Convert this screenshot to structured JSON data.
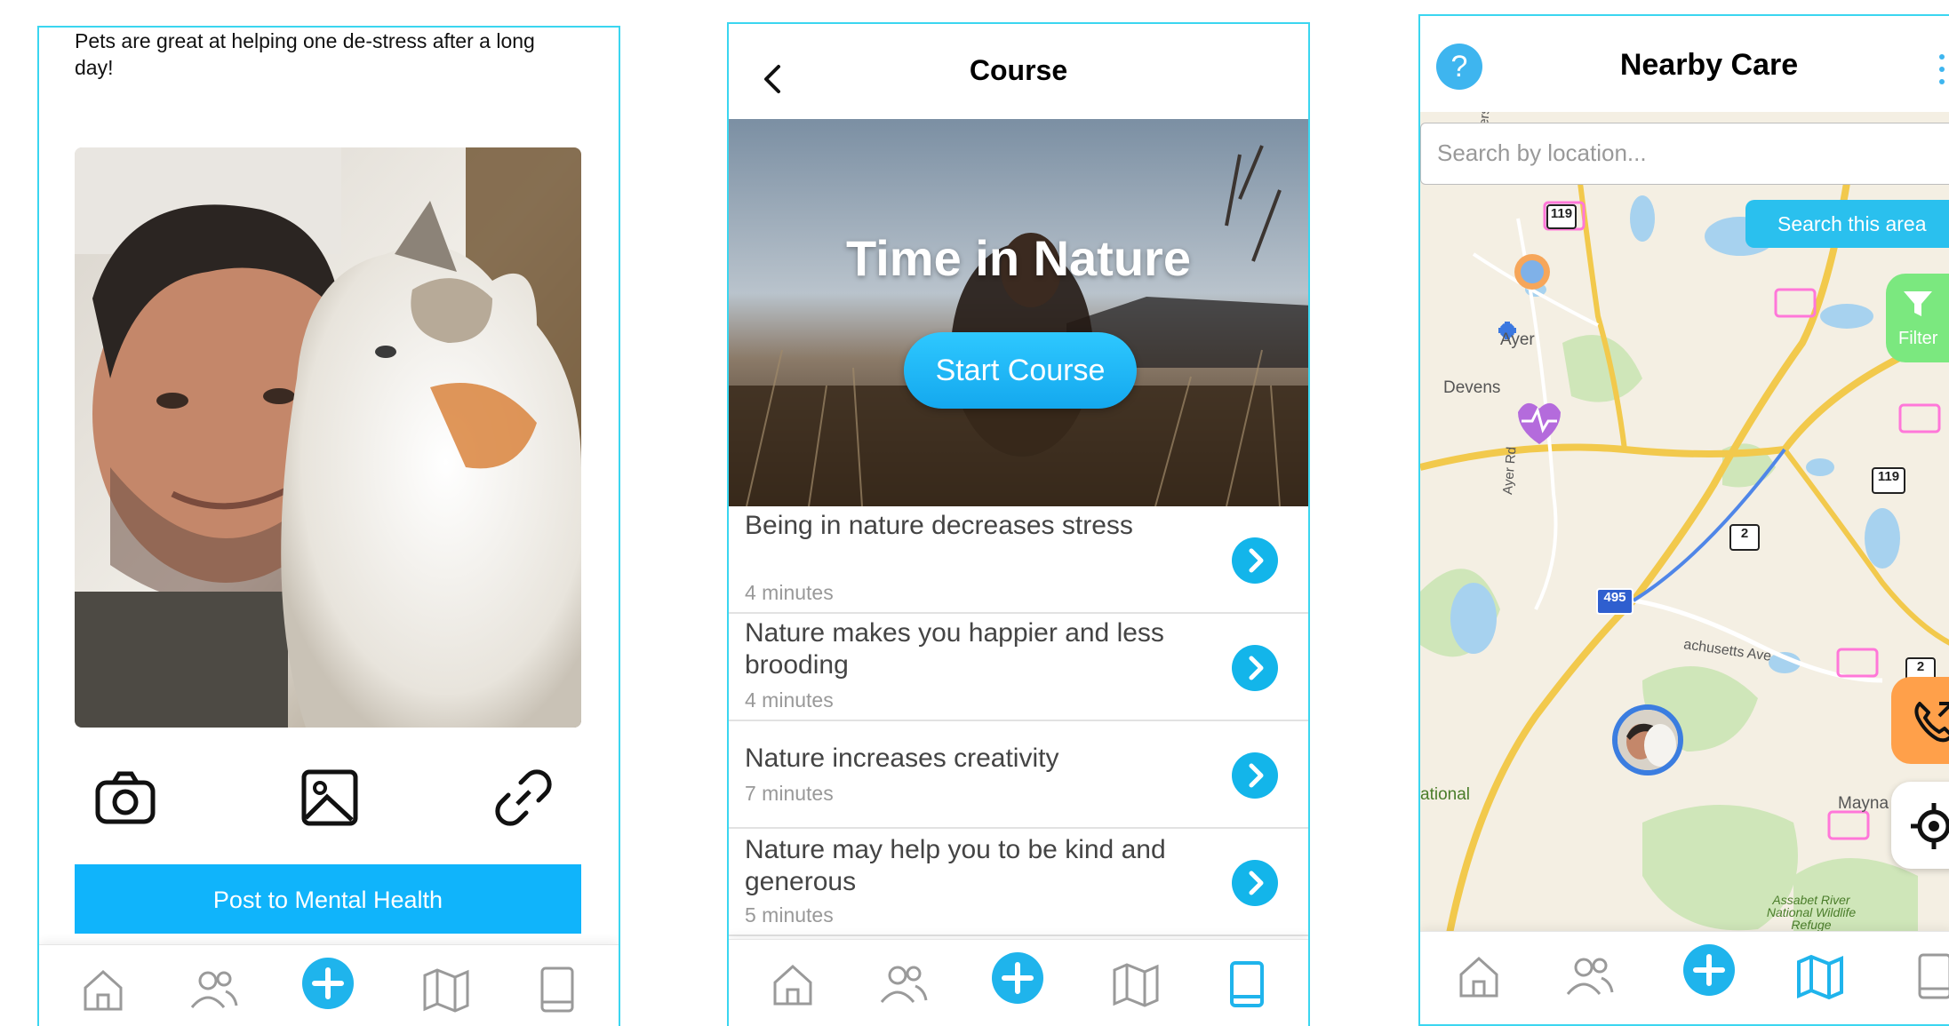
{
  "screen1": {
    "caption": "Pets are great at helping one de-stress after a long day!",
    "photo_icon": "selfie-with-cat-photo",
    "attach": {
      "camera_icon": "camera-icon",
      "gallery_icon": "image-icon",
      "link_icon": "link-icon"
    },
    "post_button": "Post to Mental Health"
  },
  "screen2": {
    "title": "Course",
    "hero_title": "Time in Nature",
    "start_button": "Start Course",
    "lessons": [
      {
        "title": "Being in nature decreases stress",
        "duration": "4 minutes"
      },
      {
        "title": "Nature makes you happier and less brooding",
        "duration": "4 minutes"
      },
      {
        "title": "Nature increases creativity",
        "duration": "7 minutes"
      },
      {
        "title": "Nature may help you to be kind and generous",
        "duration": "5 minutes"
      }
    ]
  },
  "screen3": {
    "title": "Nearby Care",
    "help_glyph": "?",
    "search_placeholder": "Search by location...",
    "search_area_button": "Search this area",
    "filter_label": "Filter",
    "map_labels": {
      "ayer": "Ayer",
      "devens": "Devens",
      "farmers_row": "Farmers Row",
      "ayer_rd": "Ayer Rd",
      "massachusetts_ave": "achusetts Ave",
      "national": "ational",
      "maynard": "Mayna",
      "refuge": "Assabet River National Wildlife Refuge",
      "route_119_a": "119",
      "route_119_b": "119",
      "route_2_a": "2",
      "route_2_b": "2",
      "interstate": "495"
    }
  },
  "tabbar": {
    "tabs": [
      "home-icon",
      "people-icon",
      "plus-icon",
      "map-icon",
      "book-icon"
    ],
    "active_color": "#1fb4ec",
    "inactive_color": "#9a9a9a"
  },
  "colors": {
    "accent": "#10b4fb",
    "frame": "#3bd6f0"
  }
}
